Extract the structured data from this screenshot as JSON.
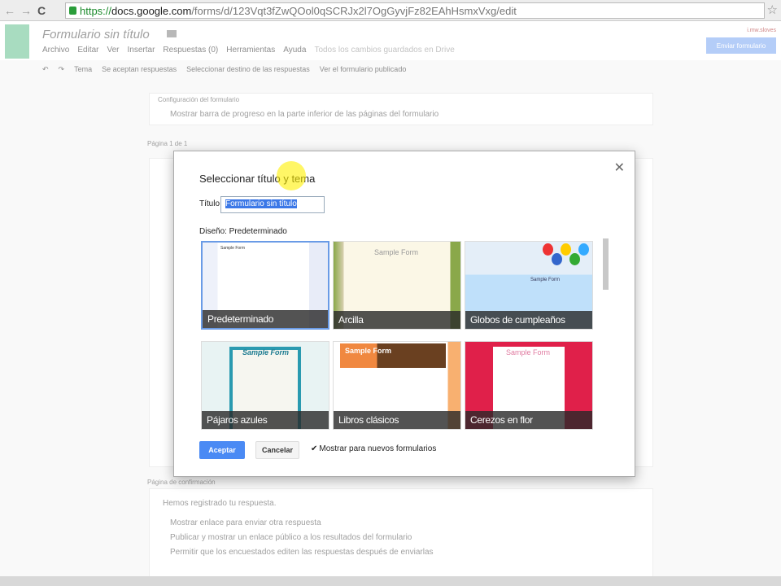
{
  "browser": {
    "url_scheme": "https://",
    "url_host": "docs.google.com",
    "url_path": "/forms/d/123Vqt3fZwQOol0qSCRJx2l7OgGyvjFz82EAhHsmxVxg/edit"
  },
  "app": {
    "doc_title": "Formulario sin título",
    "user": "i.mw.sloves",
    "send_button": "Enviar formulario",
    "menu": [
      "Archivo",
      "Editar",
      "Ver",
      "Insertar",
      "Respuestas (0)",
      "Herramientas",
      "Ayuda"
    ],
    "saved_status": "Todos los cambios guardados en Drive",
    "toolbar": [
      "Tema",
      "Se aceptan respuestas",
      "Seleccionar destino de las respuestas",
      "Ver el formulario publicado"
    ],
    "settings_header": "Configuración del formulario",
    "progress_option": "Mostrar barra de progreso en la parte inferior de las páginas del formulario",
    "page_label": "Página 1 de 1",
    "confirm_header": "Página de confirmación",
    "confirm_text": "Hemos registrado tu respuesta.",
    "confirm_options": [
      "Mostrar enlace para enviar otra respuesta",
      "Publicar y mostrar un enlace público a los resultados del formulario",
      "Permitir que los encuestados editen las respuestas después de enviarlas"
    ]
  },
  "dialog": {
    "title": "Seleccionar título y tema",
    "title_label": "Título",
    "title_value": "Formulario sin título",
    "design_label": "Diseño: Predeterminado",
    "themes": [
      {
        "name": "Predeterminado",
        "selected": true,
        "bg": "#ffffff",
        "accent": "#e8ecf8"
      },
      {
        "name": "Arcilla",
        "selected": false,
        "bg": "#fbf7e6",
        "accent": "#8aa84a"
      },
      {
        "name": "Globos de cumpleaños",
        "selected": false,
        "bg": "#cfe8fb",
        "accent": "#3a7ad8"
      },
      {
        "name": "Pájaros azules",
        "selected": false,
        "bg": "#e8f3f3",
        "accent": "#2a9ab0"
      },
      {
        "name": "Libros clásicos",
        "selected": false,
        "bg": "#ffffff",
        "accent": "#f08840"
      },
      {
        "name": "Cerezos en flor",
        "selected": false,
        "bg": "#e0204a",
        "accent": "#ffffff"
      }
    ],
    "sample_text": "Sample Form",
    "accept": "Aceptar",
    "cancel": "Cancelar",
    "show_new_label": "Mostrar para nuevos formularios",
    "show_new_checked": true
  }
}
